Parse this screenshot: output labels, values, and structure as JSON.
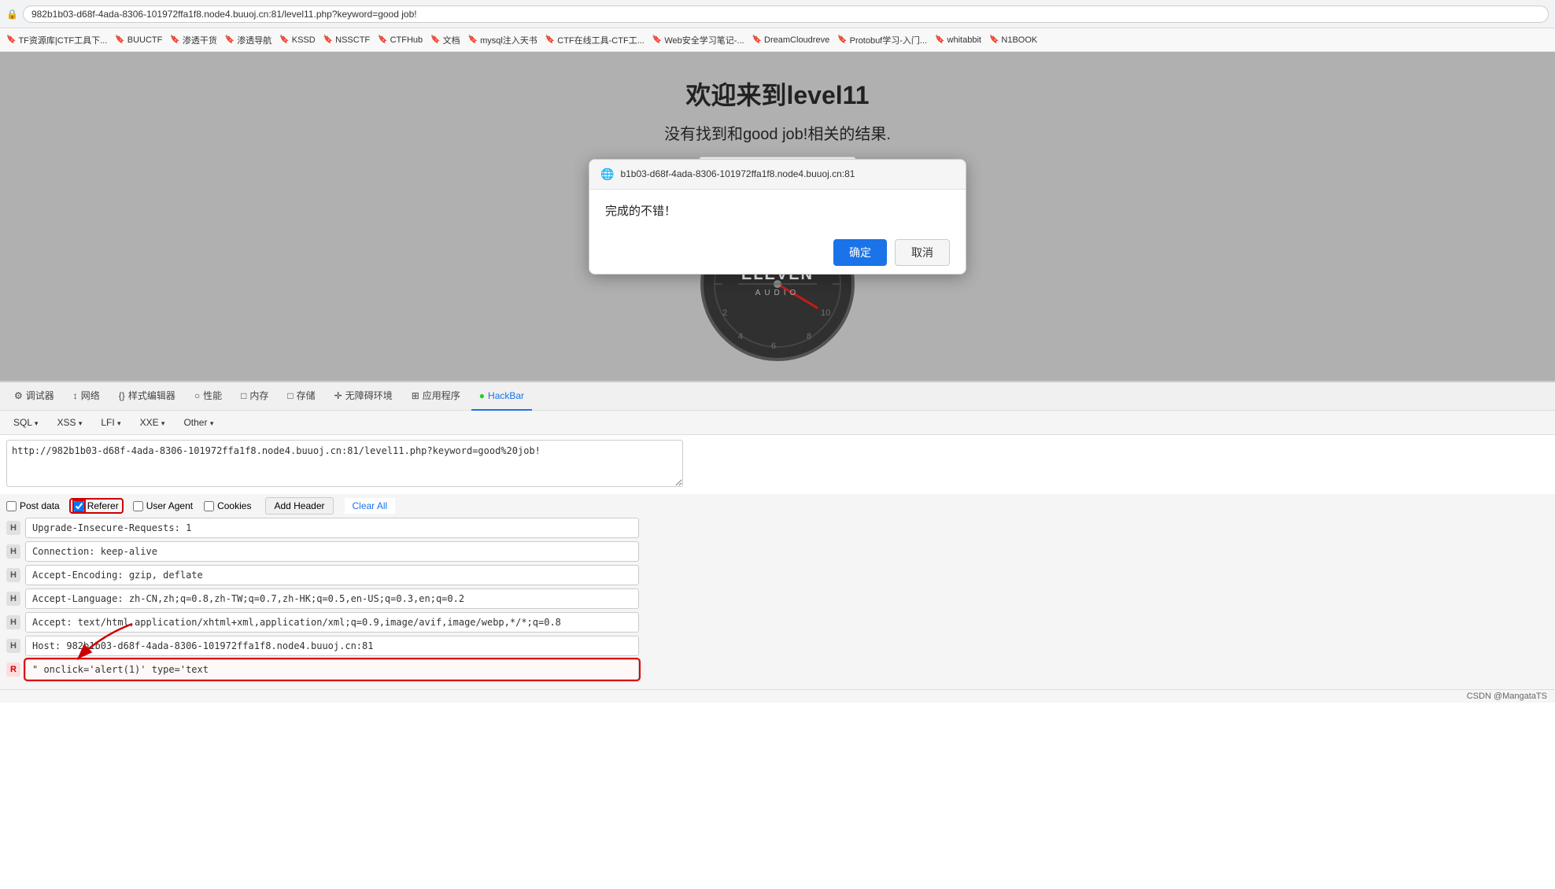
{
  "browser": {
    "url": "982b1b03-d68f-4ada-8306-101972ffa1f8.node4.buuoj.cn:81/level11.php?keyword=good job!",
    "title": "982b1b03-d68f-4ada-8306-101972ffa1f8.node4.buuoj.cn:81/level11.php?keyword=good job!"
  },
  "bookmarks": [
    {
      "label": "TF资源库|CTF工具下...",
      "icon": "🔖"
    },
    {
      "label": "BUUCTF",
      "icon": "🔖"
    },
    {
      "label": "渗透干货",
      "icon": "🔖"
    },
    {
      "label": "渗透导航",
      "icon": "🔖"
    },
    {
      "label": "KSSD",
      "icon": "🔖"
    },
    {
      "label": "NSSCTF",
      "icon": "🔖"
    },
    {
      "label": "CTFHub",
      "icon": "🔖"
    },
    {
      "label": "文档",
      "icon": "🔖"
    },
    {
      "label": "mysql注入天书",
      "icon": "🔖"
    },
    {
      "label": "CTF在线工具-CTF工...",
      "icon": "🔖"
    },
    {
      "label": "Web安全学习笔记-...",
      "icon": "🔖"
    },
    {
      "label": "DreamCloudreve",
      "icon": "🔖"
    },
    {
      "label": "Protobuf学习-入门...",
      "icon": "🔖"
    },
    {
      "label": "whitabbit",
      "icon": "🔖"
    },
    {
      "label": "N1BOOK",
      "icon": "🔖"
    }
  ],
  "page": {
    "title": "欢迎来到level11",
    "subtitle_before": "没有找到和good job!相关的结果.",
    "subtitle_strikethrough": "good job!",
    "background_color": "#b0b0b0"
  },
  "dialog": {
    "url": "b1b03-d68f-4ada-8306-101972ffa1f8.node4.buuoj.cn:81",
    "message": "完成的不错！",
    "confirm_label": "确定",
    "cancel_label": "取消"
  },
  "devtools": {
    "tabs": [
      {
        "label": "调试器",
        "icon": "⚙"
      },
      {
        "label": "网络",
        "icon": "↕"
      },
      {
        "label": "样式编辑器",
        "icon": "{}"
      },
      {
        "label": "性能",
        "icon": "○"
      },
      {
        "label": "内存",
        "icon": "□"
      },
      {
        "label": "存储",
        "icon": "□"
      },
      {
        "label": "无障碍环境",
        "icon": "✛"
      },
      {
        "label": "应用程序",
        "icon": "⊞"
      },
      {
        "label": "HackBar",
        "icon": "●",
        "active": true
      }
    ]
  },
  "hackbar": {
    "menus": [
      {
        "label": "SQL",
        "arrow": "▾"
      },
      {
        "label": "XSS",
        "arrow": "▾"
      },
      {
        "label": "LFI",
        "arrow": "▾"
      },
      {
        "label": "XXE",
        "arrow": "▾"
      },
      {
        "label": "Other",
        "arrow": "▾"
      }
    ],
    "url_value": "http://982b1b03-d68f-4ada-8306-101972ffa1f8.node4.buuoj.cn:81/level11.php?keyword=good%20job!",
    "checkboxes": [
      {
        "label": "Post data",
        "checked": false,
        "highlighted": false
      },
      {
        "label": "Referer",
        "checked": true,
        "highlighted": true
      },
      {
        "label": "User Agent",
        "checked": false,
        "highlighted": false
      },
      {
        "label": "Cookies",
        "checked": false,
        "highlighted": false
      }
    ],
    "add_header_label": "Add Header",
    "clear_all_label": "Clear All",
    "headers": [
      {
        "tag": "H",
        "value": "Upgrade-Insecure-Requests: 1",
        "highlighted": false
      },
      {
        "tag": "H",
        "value": "Connection: keep-alive",
        "highlighted": false
      },
      {
        "tag": "H",
        "value": "Accept-Encoding: gzip, deflate",
        "highlighted": false
      },
      {
        "tag": "H",
        "value": "Accept-Language: zh-CN,zh;q=0.8,zh-TW;q=0.7,zh-HK;q=0.5,en-US;q=0.3,en;q=0.2",
        "highlighted": false
      },
      {
        "tag": "H",
        "value": "Accept: text/html,application/xhtml+xml,application/xml;q=0.9,image/avif,image/webp,*/*;q=0.8",
        "highlighted": false
      },
      {
        "tag": "H",
        "value": "Host: 982b1b03-d68f-4ada-8306-101972ffa1f8.node4.buuoj.cn:81",
        "highlighted": false
      },
      {
        "tag": "R",
        "value": "\" onclick='alert(1)' type='text",
        "highlighted": true
      }
    ]
  },
  "statusbar": {
    "label": "CSDN @MangataTS"
  }
}
